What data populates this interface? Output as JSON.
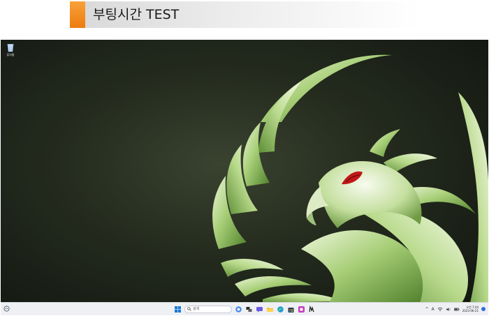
{
  "heading": {
    "title": "부팅시간 TEST",
    "accent_color": "#f08a1c"
  },
  "desktop": {
    "wallpaper": "green-phoenix-wallpaper",
    "icons": [
      {
        "label": "휴지통",
        "icon": "recycle-bin-icon"
      }
    ]
  },
  "taskbar": {
    "widgets_icon": "widgets-icon",
    "search_placeholder": "검색",
    "pinned": [
      "start-icon",
      "copilot-icon",
      "task-view-icon",
      "chat-icon",
      "file-explorer-icon",
      "edge-icon",
      "store-icon",
      "app-icon",
      "phoenix-app-icon"
    ],
    "tray": {
      "overflow": "^",
      "ime": "A",
      "clock_time": "오전 7:44",
      "clock_date": "2023-06-21"
    }
  }
}
